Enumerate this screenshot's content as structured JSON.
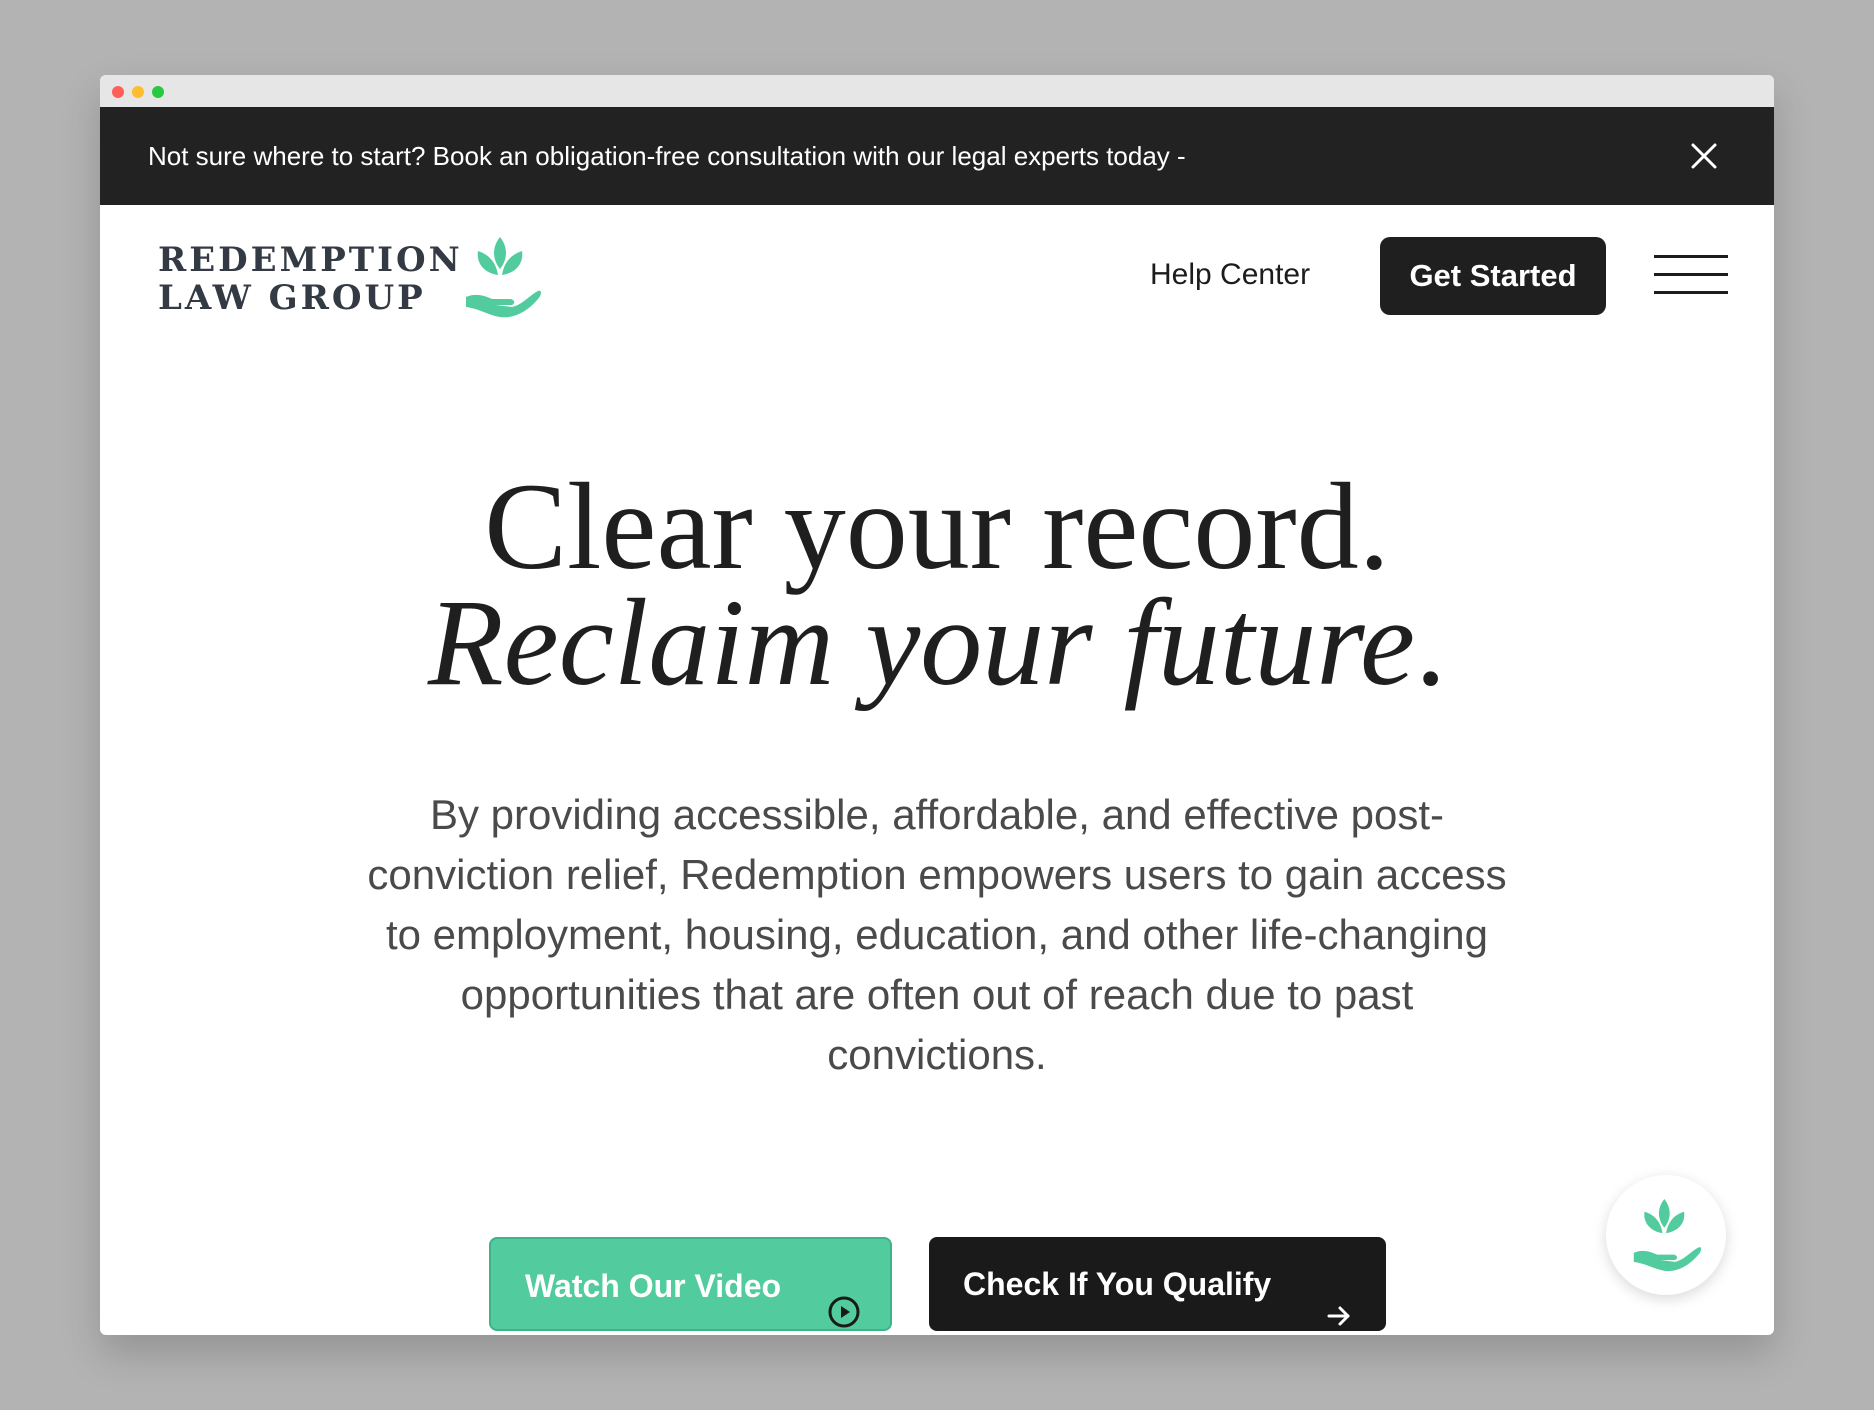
{
  "window": {
    "traffic_colors": [
      "#ff5f57",
      "#febc2e",
      "#28c840"
    ]
  },
  "announcement": {
    "text": "Not sure where to start? Book an obligation-free consultation with our legal experts today -",
    "close_icon": "close-icon"
  },
  "header": {
    "logo_line1": "REDEMPTION",
    "logo_line2": "LAW GROUP",
    "logo_icon": "sprout-in-hand-icon",
    "nav_help": "Help Center",
    "cta_label": "Get Started",
    "menu_icon": "hamburger-menu-icon"
  },
  "hero": {
    "headline_line1": "Clear your record.",
    "headline_line2": "Reclaim your future",
    "headline_line2_end": ".",
    "lead": "By providing accessible, affordable, and effective post-conviction relief, Redemption empowers users to gain access to employment, housing, education, and other life-changing opportunities that are often out of reach due to past convictions.",
    "btn_video": "Watch Our Video",
    "btn_video_icon": "play-circle-icon",
    "btn_qualify": "Check If You Qualify",
    "btn_qualify_icon": "arrow-right-icon"
  },
  "float_badge": {
    "icon": "sprout-in-hand-icon"
  },
  "colors": {
    "accent_green": "#52cc9f",
    "dark": "#1f1f1f",
    "announcement_bg": "#222222"
  }
}
